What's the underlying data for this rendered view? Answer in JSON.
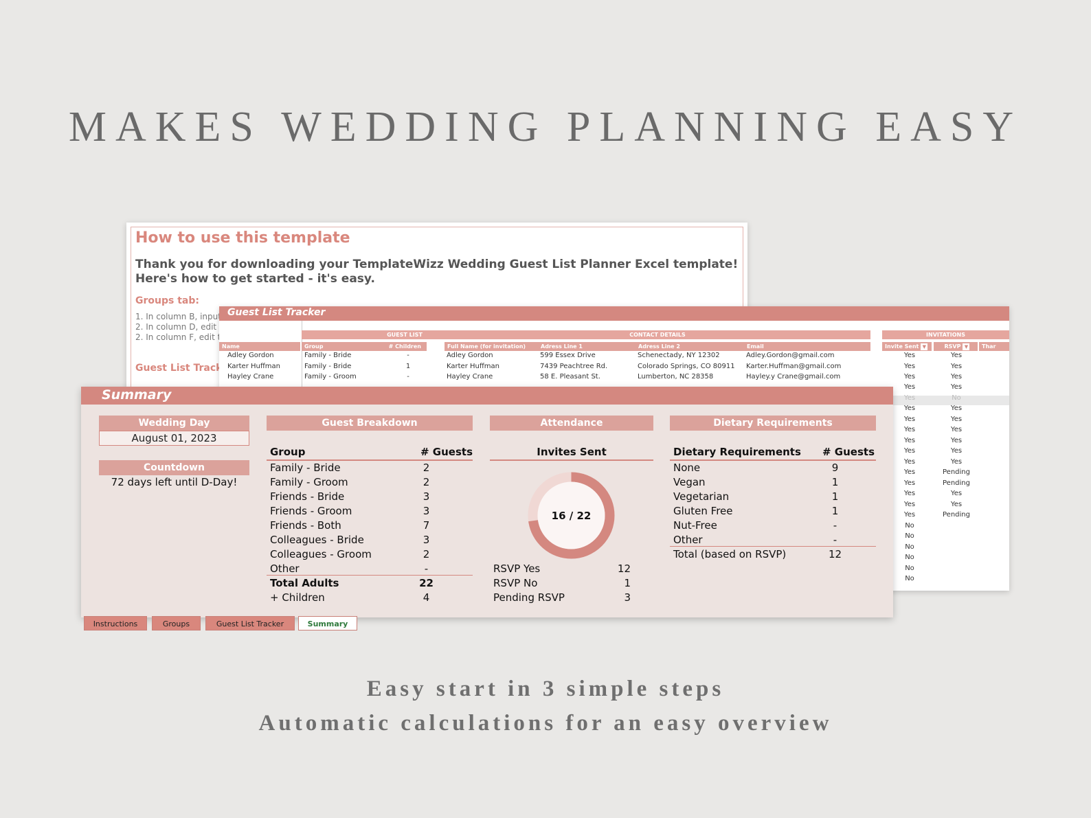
{
  "hero": "MAKES WEDDING PLANNING EASY",
  "taglines": [
    "Easy start in 3 simple steps",
    "Automatic calculations for an easy overview"
  ],
  "instructions": {
    "title": "How to use this template",
    "intro_line1": "Thank you for downloading your TemplateWizz Wedding Guest List Planner Excel template!",
    "intro_line2": "Here's how to get started - it's easy.",
    "groups_heading": "Groups tab:",
    "steps": [
      "1. In column B, input",
      "2. In column D, edit t",
      "2. In column F, edit th"
    ],
    "tracker_heading": "Guest List Tracker"
  },
  "tracker": {
    "title": "Guest List Tracker",
    "sections": {
      "guest_list": "GUEST LIST",
      "contact": "CONTACT DETAILS",
      "invitations": "INVITATIONS"
    },
    "columns": {
      "name": "Name",
      "group": "Group",
      "children": "# Children",
      "full_name": "Full Name (for invitation)",
      "addr1": "Adress Line 1",
      "addr2": "Adress Line 2",
      "email": "Email",
      "invite_sent": "Invite Sent",
      "rsvp": "RSVP",
      "thanks": "Thar"
    },
    "rows": [
      {
        "name": "Adley Gordon",
        "group": "Family - Bride",
        "children": "-",
        "full_name": "Adley Gordon",
        "addr1": "599 Essex Drive",
        "addr2": "Schenectady, NY 12302",
        "email": "Adley.Gordon@gmail.com",
        "sent": "Yes",
        "rsvp": "Yes"
      },
      {
        "name": "Karter Huffman",
        "group": "Family - Bride",
        "children": "1",
        "full_name": "Karter Huffman",
        "addr1": "7439 Peachtree Rd.",
        "addr2": "Colorado Springs, CO 80911",
        "email": "Karter.Huffman@gmail.com",
        "sent": "Yes",
        "rsvp": "Yes"
      },
      {
        "name": "Hayley Crane",
        "group": "Family - Groom",
        "children": "-",
        "full_name": "Hayley Crane",
        "addr1": "58 E. Pleasant St.",
        "addr2": "Lumberton, NC 28358",
        "email": "Hayley.y Crane@gmail.com",
        "sent": "Yes",
        "rsvp": "Yes"
      }
    ],
    "more_sent": [
      "Yes",
      "Yes",
      "Yes",
      "Yes",
      "Yes",
      "Yes",
      "Yes",
      "Yes",
      "Yes",
      "Yes",
      "Yes",
      "Yes",
      "Yes",
      "No",
      "No",
      "No",
      "No",
      "No",
      "No"
    ],
    "more_rsvp": [
      "Yes",
      "No",
      "Yes",
      "Yes",
      "Yes",
      "Yes",
      "Yes",
      "Yes",
      "Pending",
      "Pending",
      "Yes",
      "Yes",
      "Pending",
      "",
      "",
      "",
      "",
      "",
      ""
    ]
  },
  "summary": {
    "title": "Summary",
    "wedding_day_label": "Wedding Day",
    "wedding_day": "August 01, 2023",
    "countdown_label": "Countdown",
    "countdown": "72 days left until D-Day!",
    "breakdown": {
      "header": "Guest Breakdown",
      "col_group": "Group",
      "col_guests": "# Guests",
      "rows": [
        {
          "group": "Family - Bride",
          "guests": "2"
        },
        {
          "group": "Family - Groom",
          "guests": "2"
        },
        {
          "group": "Friends - Bride",
          "guests": "3"
        },
        {
          "group": "Friends - Groom",
          "guests": "3"
        },
        {
          "group": "Friends - Both",
          "guests": "7"
        },
        {
          "group": "Colleagues - Bride",
          "guests": "3"
        },
        {
          "group": "Colleagues - Groom",
          "guests": "2"
        },
        {
          "group": "Other",
          "guests": "-"
        }
      ],
      "total_label": "Total Adults",
      "total": "22",
      "children_label": "+ Children",
      "children": "4"
    },
    "attendance": {
      "header": "Attendance",
      "invites_label": "Invites Sent",
      "donut_label": "16 / 22",
      "sent": 16,
      "total": 22,
      "rsvp_yes_label": "RSVP Yes",
      "rsvp_yes": "12",
      "rsvp_no_label": "RSVP No",
      "rsvp_no": "1",
      "pending_label": "Pending RSVP",
      "pending": "3",
      "colors": {
        "filled": "#d48880",
        "empty": "#f0d8d4"
      }
    },
    "dietary": {
      "header": "Dietary Requirements",
      "col_req": "Dietary Requirements",
      "col_guests": "# Guests",
      "rows": [
        {
          "req": "None",
          "guests": "9"
        },
        {
          "req": "Vegan",
          "guests": "1"
        },
        {
          "req": "Vegetarian",
          "guests": "1"
        },
        {
          "req": "Gluten Free",
          "guests": "1"
        },
        {
          "req": "Nut-Free",
          "guests": "-"
        },
        {
          "req": "Other",
          "guests": "-"
        }
      ],
      "total_label": "Total (based on RSVP)",
      "total": "12"
    }
  },
  "tabs": [
    "Instructions",
    "Groups",
    "Guest List Tracker",
    "Summary"
  ],
  "active_tab": "Summary",
  "colors": {
    "accent": "#d48880",
    "accent_light": "#dba29b",
    "panel_bg": "#ede3e0",
    "page_bg": "#e9e8e6"
  }
}
